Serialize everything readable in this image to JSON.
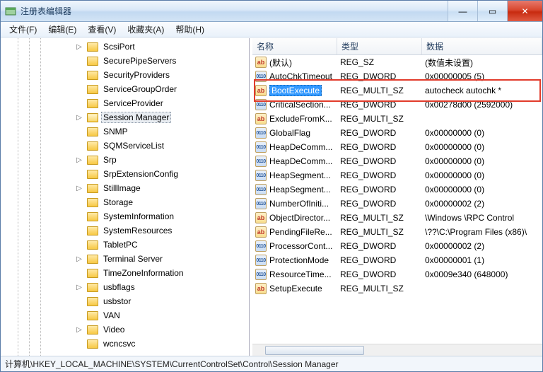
{
  "window": {
    "title": "注册表编辑器"
  },
  "menu": [
    "文件(F)",
    "编辑(E)",
    "查看(V)",
    "收藏夹(A)",
    "帮助(H)"
  ],
  "tree": {
    "indent_base": 104,
    "items": [
      {
        "expander": "▷",
        "label": "ScsiPort"
      },
      {
        "expander": "",
        "label": "SecurePipeServers"
      },
      {
        "expander": "",
        "label": "SecurityProviders"
      },
      {
        "expander": "",
        "label": "ServiceGroupOrder"
      },
      {
        "expander": "",
        "label": "ServiceProvider"
      },
      {
        "expander": "▷",
        "label": "Session Manager",
        "selected": true,
        "open": true
      },
      {
        "expander": "",
        "label": "SNMP"
      },
      {
        "expander": "",
        "label": "SQMServiceList"
      },
      {
        "expander": "▷",
        "label": "Srp"
      },
      {
        "expander": "",
        "label": "SrpExtensionConfig"
      },
      {
        "expander": "▷",
        "label": "StillImage"
      },
      {
        "expander": "",
        "label": "Storage"
      },
      {
        "expander": "",
        "label": "SystemInformation"
      },
      {
        "expander": "",
        "label": "SystemResources"
      },
      {
        "expander": "",
        "label": "TabletPC"
      },
      {
        "expander": "▷",
        "label": "Terminal Server"
      },
      {
        "expander": "",
        "label": "TimeZoneInformation"
      },
      {
        "expander": "▷",
        "label": "usbflags"
      },
      {
        "expander": "",
        "label": "usbstor"
      },
      {
        "expander": "",
        "label": "VAN"
      },
      {
        "expander": "▷",
        "label": "Video"
      },
      {
        "expander": "",
        "label": "wcncsvc"
      }
    ]
  },
  "list": {
    "headers": {
      "name": "名称",
      "type": "类型",
      "data": "数据"
    },
    "rows": [
      {
        "icon": "ab",
        "name": "(默认)",
        "type": "REG_SZ",
        "data": "(数值未设置)"
      },
      {
        "icon": "bin",
        "name": "AutoChkTimeout",
        "type": "REG_DWORD",
        "data": "0x00000005 (5)"
      },
      {
        "icon": "ab",
        "name": "BootExecute",
        "type": "REG_MULTI_SZ",
        "data": "autocheck autochk *",
        "selected": true
      },
      {
        "icon": "bin",
        "name": "CriticalSection...",
        "type": "REG_DWORD",
        "data": "0x00278d00 (2592000)"
      },
      {
        "icon": "ab",
        "name": "ExcludeFromK...",
        "type": "REG_MULTI_SZ",
        "data": ""
      },
      {
        "icon": "bin",
        "name": "GlobalFlag",
        "type": "REG_DWORD",
        "data": "0x00000000 (0)"
      },
      {
        "icon": "bin",
        "name": "HeapDeComm...",
        "type": "REG_DWORD",
        "data": "0x00000000 (0)"
      },
      {
        "icon": "bin",
        "name": "HeapDeComm...",
        "type": "REG_DWORD",
        "data": "0x00000000 (0)"
      },
      {
        "icon": "bin",
        "name": "HeapSegment...",
        "type": "REG_DWORD",
        "data": "0x00000000 (0)"
      },
      {
        "icon": "bin",
        "name": "HeapSegment...",
        "type": "REG_DWORD",
        "data": "0x00000000 (0)"
      },
      {
        "icon": "bin",
        "name": "NumberOfIniti...",
        "type": "REG_DWORD",
        "data": "0x00000002 (2)"
      },
      {
        "icon": "ab",
        "name": "ObjectDirector...",
        "type": "REG_MULTI_SZ",
        "data": "\\Windows \\RPC Control"
      },
      {
        "icon": "ab",
        "name": "PendingFileRe...",
        "type": "REG_MULTI_SZ",
        "data": "\\??\\C:\\Program Files (x86)\\"
      },
      {
        "icon": "bin",
        "name": "ProcessorCont...",
        "type": "REG_DWORD",
        "data": "0x00000002 (2)"
      },
      {
        "icon": "bin",
        "name": "ProtectionMode",
        "type": "REG_DWORD",
        "data": "0x00000001 (1)"
      },
      {
        "icon": "bin",
        "name": "ResourceTime...",
        "type": "REG_DWORD",
        "data": "0x0009e340 (648000)"
      },
      {
        "icon": "ab",
        "name": "SetupExecute",
        "type": "REG_MULTI_SZ",
        "data": ""
      }
    ],
    "highlight_row": 2
  },
  "status": "计算机\\HKEY_LOCAL_MACHINE\\SYSTEM\\CurrentControlSet\\Control\\Session Manager",
  "icon_text": {
    "ab": "ab",
    "bin": "011\n110"
  },
  "win_btn": {
    "min": "—",
    "max": "▭",
    "close": "✕"
  }
}
